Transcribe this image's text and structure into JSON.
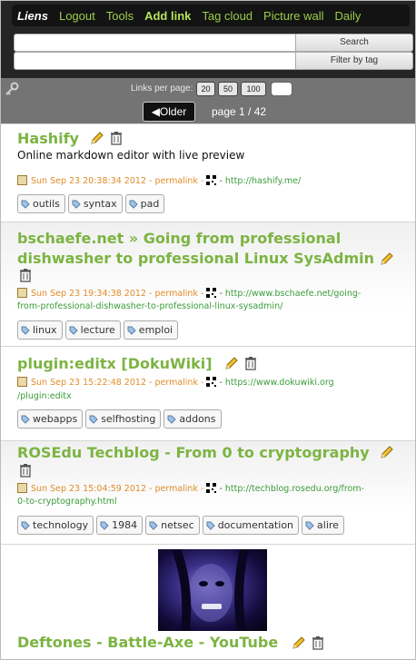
{
  "nav": {
    "brand": "Liens",
    "items": [
      "Logout",
      "Tools",
      "Add link",
      "Tag cloud",
      "Picture wall",
      "Daily"
    ]
  },
  "search": {
    "search_label": "Search",
    "filter_label": "Filter by tag"
  },
  "paging": {
    "links_per_page_label": "Links per page:",
    "options": [
      "20",
      "50",
      "100"
    ],
    "older_label": "◀Older",
    "page_text": "page 1 / 42"
  },
  "links": [
    {
      "title": "Hashify",
      "description": "Online markdown editor with live preview",
      "date": "Sun Sep 23 20:38:34 2012",
      "permalink": "permalink",
      "url": "http://hashify.me/",
      "tags": [
        "outils",
        "syntax",
        "pad"
      ]
    },
    {
      "title_line1": "bschaefe.net » Going from professional",
      "title_line2": "dishwasher to professional Linux SysAdmin",
      "date": "Sun Sep 23 19:34:38 2012",
      "permalink": "permalink",
      "url_line1": "http://www.bschaefe.net/going-",
      "url_line2": "from-professional-dishwasher-to-professional-linux-sysadmin/",
      "tags": [
        "linux",
        "lecture",
        "emploi"
      ]
    },
    {
      "title": "plugin:editx [DokuWiki]",
      "date": "Sun Sep 23 15:22:48 2012",
      "permalink": "permalink",
      "url_line1": "https://www.dokuwiki.org",
      "url_line2": "/plugin:editx",
      "tags": [
        "webapps",
        "selfhosting",
        "addons"
      ]
    },
    {
      "title": "ROSEdu Techblog - From 0 to cryptography",
      "date": "Sun Sep 23 15:04:59 2012",
      "permalink": "permalink",
      "url_line1": "http://techblog.rosedu.org/from-",
      "url_line2": "0-to-cryptography.html",
      "tags": [
        "technology",
        "1984",
        "netsec",
        "documentation",
        "alire"
      ]
    },
    {
      "title": "Deftones - Battle-Axe - YouTube"
    }
  ],
  "icons": {
    "edit": "pencil-icon",
    "delete": "trash-icon",
    "date": "calendar-icon",
    "qrcode": "qrcode-icon",
    "tag": "tag-icon",
    "key": "key-icon"
  },
  "colors": {
    "title_green": "#7cb442",
    "nav_green": "#9acd4a",
    "date_orange": "#e08c2a",
    "url_green": "#3a9d3a"
  }
}
